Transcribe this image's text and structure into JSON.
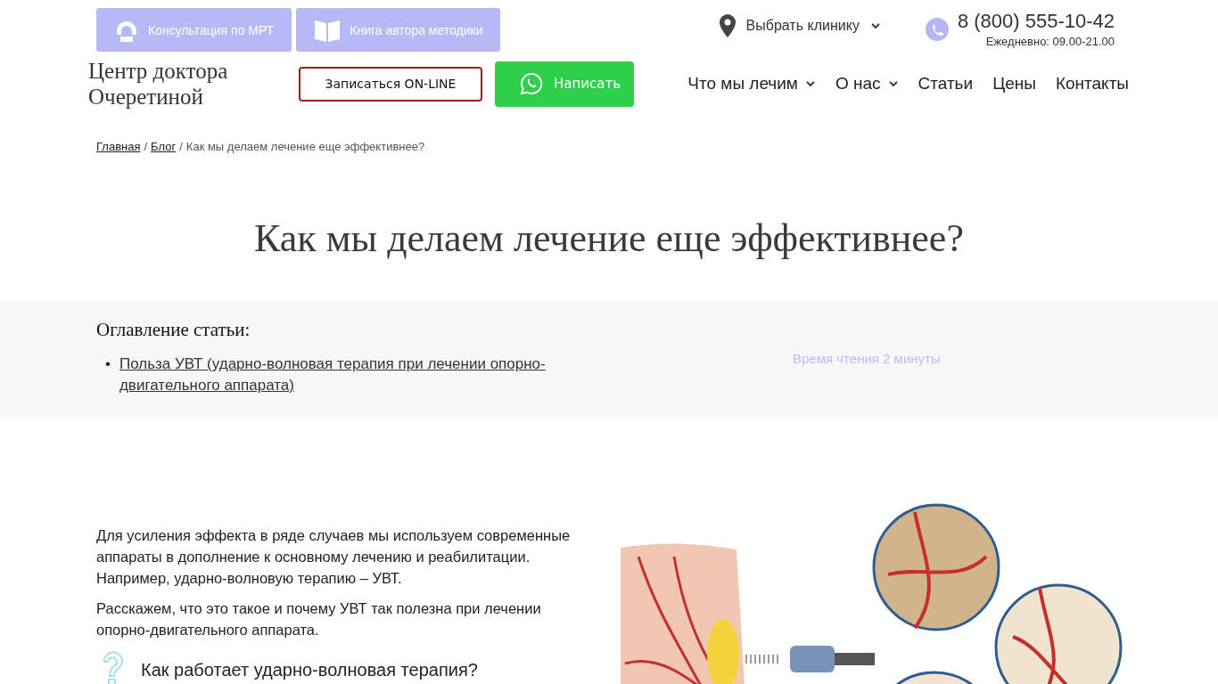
{
  "top_links": [
    {
      "label": "Консультация по МРТ",
      "kind": "mri"
    },
    {
      "label": "Книга автора методики",
      "kind": "book"
    }
  ],
  "clinic_selector": {
    "label": "Выбрать клинику"
  },
  "phone": {
    "number": "8 (800) 555-10-42",
    "hours": "Ежедневно: 09.00-21.00"
  },
  "logo": {
    "text": "Центр доктора Очеретиной"
  },
  "actions": [
    {
      "label": "Записаться ON-LINE",
      "kind": "outline"
    },
    {
      "label": "Написать",
      "kind": "whatsapp"
    }
  ],
  "nav": [
    {
      "label": "Что мы лечим",
      "dropdown": true
    },
    {
      "label": "О нас",
      "dropdown": true
    },
    {
      "label": "Статьи",
      "dropdown": false
    },
    {
      "label": "Цены",
      "dropdown": false
    },
    {
      "label": "Контакты",
      "dropdown": false
    }
  ],
  "breadcrumb": [
    {
      "label": "Главная",
      "kind": "link"
    },
    {
      "label": "/",
      "kind": "separator"
    },
    {
      "label": "Блог",
      "kind": "link"
    },
    {
      "label": "/",
      "kind": "separator"
    },
    {
      "label": "Как мы делаем лечение еще эффективнее?",
      "kind": "current"
    }
  ],
  "title": "Как мы делаем лечение еще эффективнее?",
  "toc": {
    "heading": "Оглавление статьи:",
    "items": [
      {
        "bullet": "•",
        "label": "Польза УВТ (ударно-волновая терапия при лечении опорно-двигательного аппарата)"
      }
    ],
    "reading_time": "Время чтения 2 минуты"
  },
  "article": {
    "paragraphs": [
      "Для усиления эффекта в ряде случаев мы используем современные аппараты в дополнение к основному лечению и реабилитации. Например, ударно-волновую терапию – УВТ.",
      "Расскажем, что это такое и почему УВТ так полезна при лечении опорно-двигательного аппарата."
    ],
    "subheading": "Как работает ударно-волновая терапия?"
  }
}
